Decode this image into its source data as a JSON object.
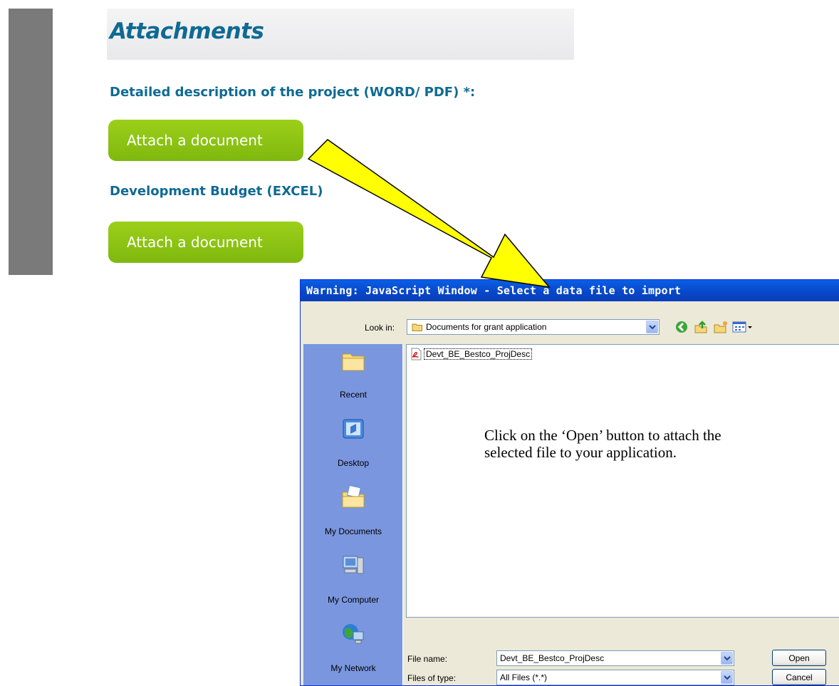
{
  "page": {
    "section_title": "Attachments",
    "fields": [
      {
        "label": "Detailed description of the project (WORD/ PDF) *:",
        "button": "Attach a document"
      },
      {
        "label": "Development Budget (EXCEL)",
        "button": "Attach a document"
      }
    ]
  },
  "dialog": {
    "title": "Warning: JavaScript Window - Select a data file to import",
    "look_in_label": "Look in:",
    "look_in_value": "Documents for grant application",
    "places": [
      "Recent",
      "Desktop",
      "My Documents",
      "My Computer",
      "My Network"
    ],
    "files": [
      {
        "name": "Devt_BE_Bestco_ProjDesc",
        "icon": "pdf-file-icon"
      }
    ],
    "instruction": "Click on the ‘Open’ button to attach the selected file to your application.",
    "file_name_label": "File name:",
    "file_name_value": "Devt_BE_Bestco_ProjDesc",
    "file_type_label": "Files of type:",
    "file_type_value": "All Files (*.*)",
    "open_button": "Open",
    "cancel_button": "Cancel"
  },
  "colors": {
    "heading_blue": "#0f6a93",
    "button_green": "#8cc414",
    "arrow_yellow": "#ffff00",
    "dialog_title_blue": "#0a54d6"
  }
}
